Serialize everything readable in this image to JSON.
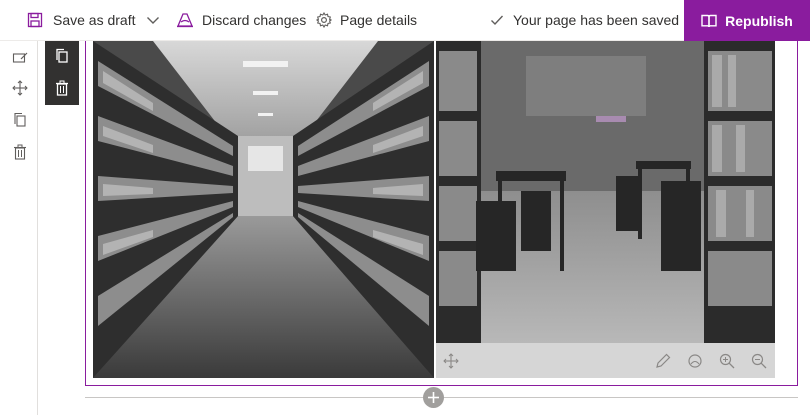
{
  "commandbar": {
    "save_label": "Save as draft",
    "discard_label": "Discard changes",
    "details_label": "Page details",
    "saved_status": "Your page has been saved",
    "republish_label": "Republish"
  },
  "rail_icons": [
    "edit-icon",
    "move-icon",
    "duplicate-icon",
    "delete-icon"
  ],
  "webpart_toolbar_icons": [
    "duplicate-icon",
    "delete-icon"
  ],
  "image_toolbar_icons": [
    "move-icon",
    "edit-icon",
    "reset-focal-icon",
    "zoom-in-icon",
    "zoom-out-icon"
  ],
  "images": [
    {
      "description_name": "library-aisle-bookshelves"
    },
    {
      "description_name": "library-reading-room-tables"
    }
  ],
  "colors": {
    "accent": "#8a1c9e",
    "toolbar_dark": "#323130",
    "image_bar": "#d6d6d6"
  }
}
